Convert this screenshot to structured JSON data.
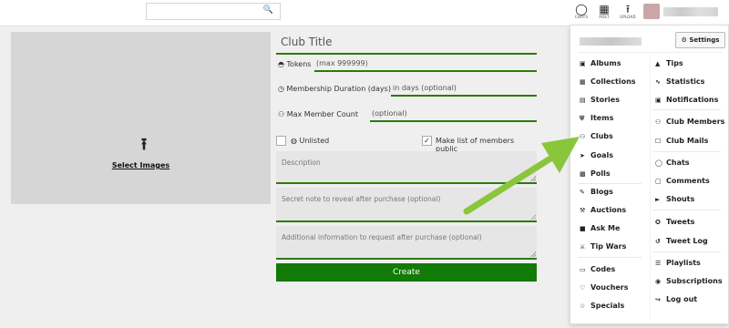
{
  "topbar": {
    "search_placeholder": "",
    "icons": [
      {
        "name": "chats",
        "label": "CHATS"
      },
      {
        "name": "post",
        "label": "POST"
      },
      {
        "name": "upload",
        "label": "UPLOAD"
      }
    ]
  },
  "upload": {
    "label": "Select Images"
  },
  "form": {
    "title_placeholder": "Club Title",
    "tokens": {
      "label": "Tokens",
      "placeholder": "(max 999999)"
    },
    "duration": {
      "label": "Membership Duration (days)",
      "placeholder": "in days (optional)"
    },
    "max_members": {
      "label": "Max Member Count",
      "placeholder": "(optional)"
    },
    "unlisted_label": "Unlisted",
    "public_label": "Make list of members public",
    "description_placeholder": "Description",
    "secret_placeholder": "Secret note to reveal after purchase (optional)",
    "additional_placeholder": "Additional information to request after purchase (optional)",
    "create_label": "Create"
  },
  "menu": {
    "settings_label": "Settings",
    "left_items": [
      "Albums",
      "Collections",
      "Stories",
      "Items",
      "Clubs",
      "Goals",
      "Polls",
      "Blogs",
      "Auctions",
      "Ask Me",
      "Tip Wars",
      "Codes",
      "Vouchers",
      "Specials"
    ],
    "right_items": [
      "Tips",
      "Statistics",
      "Notifications",
      "Club Members",
      "Club Mails",
      "Chats",
      "Comments",
      "Shouts",
      "Tweets",
      "Tweet Log",
      "Playlists",
      "Subscriptions",
      "Log out"
    ]
  },
  "colors": {
    "accent": "#127a06",
    "pointer": "#8ac63c"
  }
}
